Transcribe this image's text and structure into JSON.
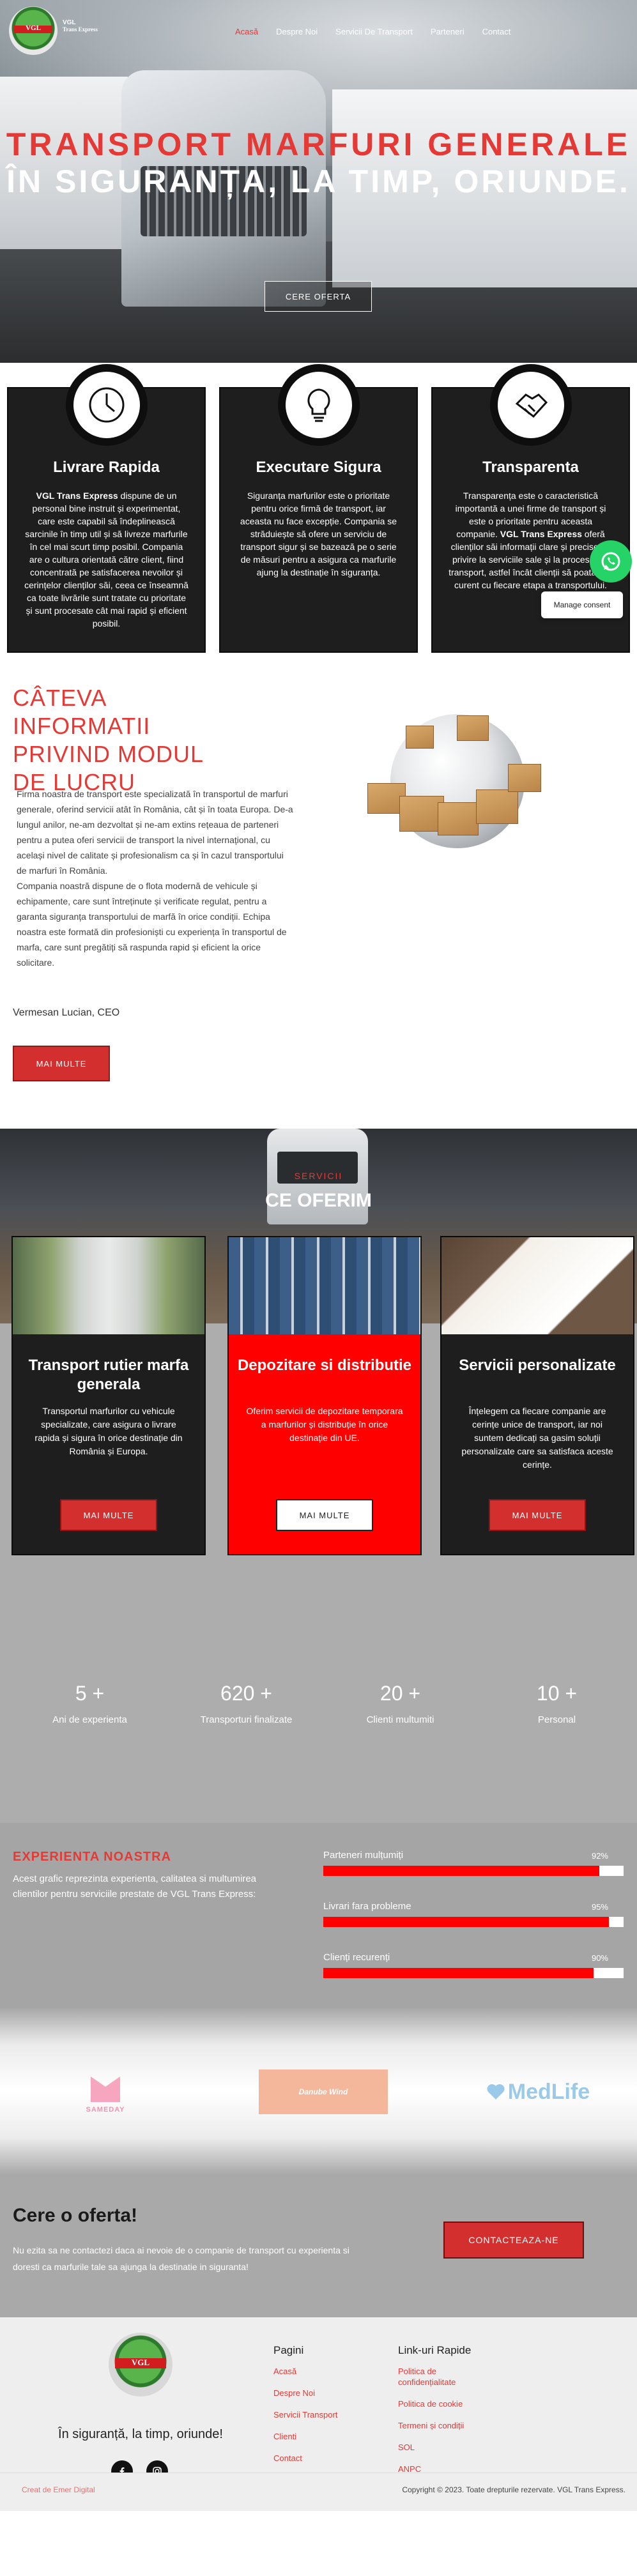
{
  "header": {
    "logo_text": "VGL",
    "brand_line1": "VGL",
    "brand_line2": "Trans Express",
    "nav": [
      "Acasă",
      "Despre Noi",
      "Servicii De Transport",
      "Parteneri",
      "Contact"
    ]
  },
  "hero": {
    "title_line1": "TRANSPORT MARFURI GENERALE",
    "title_line2": "ÎN SIGURANȚA, LA TIMP, ORIUNDE.",
    "button": "CERE OFERTA"
  },
  "features": [
    {
      "icon": "clock-icon",
      "title": "Livrare Rapida",
      "bold": "VGL Trans Express",
      "text": " dispune de un personal bine instruit și experimentat, care este capabil să îndeplinească sarcinile în timp util și să livreze marfurile în cel mai scurt timp posibil. Compania are o cultura orientată către client, fiind concentrată pe satisfacerea nevoilor și cerințelor clienților săi, ceea ce înseamnă ca toate livrările sunt tratate cu prioritate și sunt procesate cât mai rapid și eficient posibil."
    },
    {
      "icon": "lightbulb-icon",
      "title": "Executare Sigura",
      "text": "Siguranța marfurilor este o prioritate pentru orice firmă de transport, iar aceasta nu face excepție. Compania se străduiește să ofere un serviciu de transport sigur și se bazează pe o serie de măsuri pentru a asigura ca marfurile ajung la destinație în siguranța."
    },
    {
      "icon": "handshake-icon",
      "title": "Transparenta",
      "text_before": "Transparența este o caracteristică importantă a unei firme de transport și este o prioritate pentru aceasta companie. ",
      "bold": "VGL Trans Express",
      "text_after": " oferă clienților săi informații clare și precise cu privire la serviciile sale și la procesul de transport, astfel încât clienții să poata fi la curent cu fiecare etapa a transportului."
    }
  ],
  "consent": "Manage consent",
  "about": {
    "title": "CÂTEVA INFORMATII PRIVIND MODUL DE LUCRU",
    "paragraph1": "Firma noastra de transport este specializată în transportul de marfuri generale, oferind servicii atât în România, cât și în toata Europa. De-a lungul anilor, ne-am dezvoltat și ne-am extins rețeaua de parteneri pentru a putea oferi servicii de transport la nivel internațional, cu același nivel de calitate și profesionalism ca și în cazul transportului de marfuri în România.",
    "paragraph2": "Compania noastră dispune de o flota modernă de vehicule și echipamente, care sunt întreținute și verificate regulat, pentru a garanta siguranța transportului de marfă în orice condiții. Echipa noastra este formată din profesioniști cu experiența în transportul de marfa, care sunt pregătiți să raspunda rapid și eficient la orice solicitare.",
    "signature": "Vermesan Lucian, CEO",
    "button": "MAI MULTE"
  },
  "services": {
    "label": "SERVICII",
    "title": "CE OFERIM",
    "items": [
      {
        "title": "Transport rutier marfa generala",
        "text": "Transportul marfurilor cu vehicule specializate, care asigura o livrare rapida și sigura în orice destinație din România și Europa.",
        "button": "MAI MULTE"
      },
      {
        "title": "Depozitare si distributie",
        "text": "Oferim servicii de depozitare temporara a marfurilor și distribuție în orice destinație din UE.",
        "button": "MAI MULTE"
      },
      {
        "title": "Servicii personalizate",
        "text": "Înțelegem ca fiecare companie are cerințe unice de transport, iar noi suntem dedicați sa gasim soluții personalizate care sa satisfaca aceste cerințe.",
        "button": "MAI MULTE"
      }
    ]
  },
  "stats": [
    {
      "value": "5 +",
      "label": "Ani de experienta"
    },
    {
      "value": "620 +",
      "label": "Transporturi finalizate"
    },
    {
      "value": "20 +",
      "label": "Clienti multumiti"
    },
    {
      "value": "10 +",
      "label": "Personal"
    }
  ],
  "experience": {
    "title": "EXPERIENTA NOASTRA",
    "description": "Acest grafic reprezinta experienta, calitatea si multumirea clientilor pentru serviciile prestate de VGL Trans Express:",
    "bars": [
      {
        "label": "Parteneri mulțumiți",
        "percent_text": "92%",
        "value": 92
      },
      {
        "label": "Livrari fara probleme",
        "percent_text": "95%",
        "value": 95
      },
      {
        "label": "Clienți recurenți",
        "percent_text": "90%",
        "value": 90
      }
    ]
  },
  "partners": {
    "sameday": "SAMEDAY",
    "danube": "Danube Wind",
    "medlife": "MedLife"
  },
  "cta": {
    "title": "Cere o oferta!",
    "text": "Nu ezita sa ne contactezi daca ai nevoie de o companie de transport cu experienta si doresti ca marfurile tale sa ajunga la destinatie in siguranta!",
    "button": "CONTACTEAZA-NE"
  },
  "footer": {
    "logo_text": "VGL",
    "tagline": "În siguranță, la timp, oriunde!",
    "social": [
      "facebook-icon",
      "instagram-icon"
    ],
    "pages_title": "Pagini",
    "pages": [
      "Acasă",
      "Despre Noi",
      "Servicii Transport",
      "Clienti",
      "Contact"
    ],
    "quick_title": "Link-uri Rapide",
    "quick": [
      "Politica de confidențialitate",
      "Politica de cookie",
      "Termeni și condiții",
      "SOL",
      "ANPC"
    ],
    "credit": "Creat de Emer Digital",
    "copyright": "Copyright © 2023. Toate drepturile rezervate. VGL Trans Express."
  },
  "colors": {
    "accent": "#e53935",
    "dark_card": "#1e1e1e",
    "red_card": "#ff0000",
    "gray": "#adadad"
  }
}
